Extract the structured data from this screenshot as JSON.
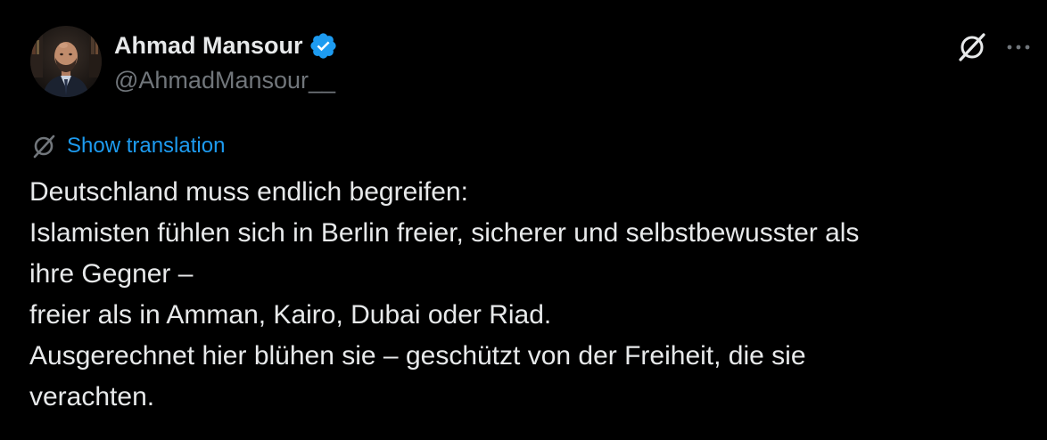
{
  "author": {
    "display_name": "Ahmad Mansour",
    "handle": "@AhmadMansour__",
    "verified": true,
    "avatar": "profile-photo",
    "verified_badge_color": "#1d9bf0"
  },
  "actions": {
    "grok_icon": "grok-icon",
    "more_icon": "more-horizontal-icon"
  },
  "translation": {
    "icon": "translate-icon",
    "label": "Show translation"
  },
  "tweet": {
    "lines": [
      "Deutschland muss endlich begreifen:",
      "Islamisten fühlen sich in Berlin freier, sicherer und selbstbewusster als",
      "ihre Gegner –",
      "freier als in Amman, Kairo, Dubai oder Riad.",
      "Ausgerechnet hier blühen sie – geschützt von der Freiheit, die sie",
      "verachten."
    ]
  },
  "colors": {
    "background": "#000000",
    "primary_text": "#e7e9ea",
    "secondary_text": "#71767b",
    "link": "#1d9bf0"
  }
}
